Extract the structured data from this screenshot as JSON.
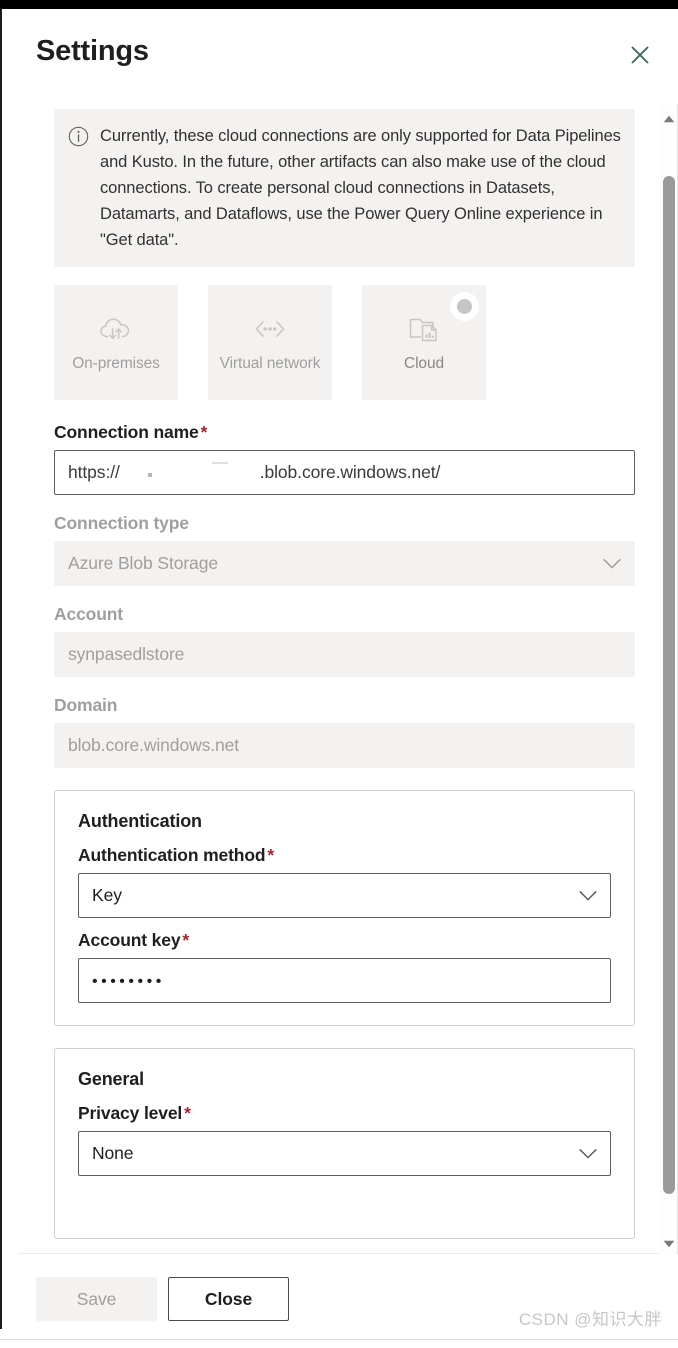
{
  "window": {
    "title": "Settings",
    "close_icon": "close-icon",
    "close_icon_color": "#3b6b62"
  },
  "info_banner": {
    "icon": "info-circle-icon",
    "text": "Currently, these cloud connections are only supported for Data Pipelines and Kusto. In the future, other artifacts can also make use of the cloud connections. To create personal cloud connections in Datasets, Datamarts, and Dataflows, use the Power Query Online experience in \"Get data\".",
    "background": "#f3f2f1"
  },
  "gateway_tiles": [
    {
      "label": "On-premises",
      "icon": "cloud-sync-icon",
      "selected": false
    },
    {
      "label": "Virtual network",
      "icon": "network-arrows-icon",
      "selected": false
    },
    {
      "label": "Cloud",
      "icon": "cloud-folder-chart-icon",
      "selected": true
    }
  ],
  "fields": {
    "connection_name": {
      "label": "Connection name",
      "required_marker": "*",
      "value_prefix": "https://",
      "value_suffix": ".blob.core.windows.net/",
      "redacted": true,
      "disabled": false
    },
    "connection_type": {
      "label": "Connection type",
      "value": "Azure Blob Storage",
      "disabled": true,
      "chevron_icon": "chevron-down-icon"
    },
    "account": {
      "label": "Account",
      "value": "synpasedlstore",
      "disabled": true
    },
    "domain": {
      "label": "Domain",
      "value": "blob.core.windows.net",
      "disabled": true
    }
  },
  "authentication_card": {
    "title": "Authentication",
    "method": {
      "label": "Authentication method",
      "required_marker": "*",
      "value": "Key",
      "chevron_icon": "chevron-down-icon"
    },
    "account_key": {
      "label": "Account key",
      "required_marker": "*",
      "value": "••••••••"
    }
  },
  "general_card": {
    "title": "General",
    "privacy_level": {
      "label": "Privacy level",
      "required_marker": "*",
      "value": "None",
      "chevron_icon": "chevron-down-icon"
    }
  },
  "footer": {
    "save_label": "Save",
    "save_disabled": true,
    "close_label": "Close"
  },
  "scrollbar": {
    "up_arrow_icon": "scroll-up-arrow-icon",
    "down_arrow_icon": "scroll-down-arrow-icon",
    "thumb_color": "#9a9a9a"
  },
  "watermark": {
    "text": "CSDN @知识大胖"
  },
  "colors": {
    "required_asterisk": "#a4262c",
    "disabled_text": "#a19f9d",
    "body_text": "#201f1e",
    "field_border": "#605e5c",
    "card_border": "#d2d0ce",
    "muted_fill": "#f3f2f1"
  }
}
